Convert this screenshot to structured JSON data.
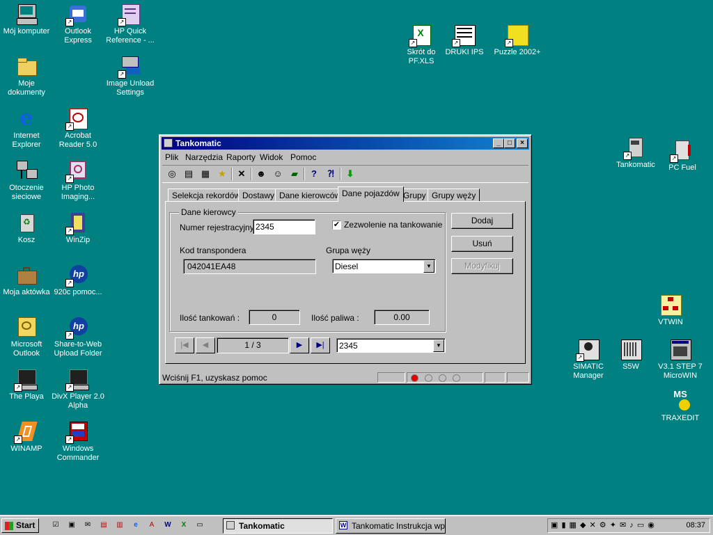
{
  "desktop_icons": [
    {
      "label": "Mój komputer",
      "icon": "computer-icon"
    },
    {
      "label": "Outlook Express",
      "icon": "outlook-express-icon"
    },
    {
      "label": "HP Quick Reference - ...",
      "icon": "hp-quick-reference-icon"
    },
    {
      "label": "Moje dokumenty",
      "icon": "folder-icon"
    },
    {
      "label": "Image Unload Settings",
      "icon": "image-unload-icon"
    },
    {
      "label": "Internet Explorer",
      "icon": "internet-explorer-icon"
    },
    {
      "label": "Acrobat Reader 5.0",
      "icon": "acrobat-icon"
    },
    {
      "label": "Otoczenie sieciowe",
      "icon": "network-icon"
    },
    {
      "label": "HP Photo Imaging...",
      "icon": "hp-photo-icon"
    },
    {
      "label": "Kosz",
      "icon": "recycle-bin-icon"
    },
    {
      "label": "WinZip",
      "icon": "winzip-icon"
    },
    {
      "label": "Moja aktówka",
      "icon": "briefcase-icon"
    },
    {
      "label": "920c pomoc...",
      "icon": "hp-920c-icon"
    },
    {
      "label": "Microsoft Outlook",
      "icon": "ms-outlook-icon"
    },
    {
      "label": "Share-to-Web Upload Folder",
      "icon": "share-to-web-icon"
    },
    {
      "label": "The Playa",
      "icon": "the-playa-icon"
    },
    {
      "label": "DivX Player 2.0 Alpha",
      "icon": "divx-icon"
    },
    {
      "label": "WINAMP",
      "icon": "winamp-icon"
    },
    {
      "label": "Windows Commander",
      "icon": "windows-commander-icon"
    },
    {
      "label": "Skrót do PF.XLS",
      "icon": "excel-icon"
    },
    {
      "label": "DRUKI IPS",
      "icon": "druki-icon"
    },
    {
      "label": "Puzzle 2002+",
      "icon": "puzzle-icon"
    },
    {
      "label": "Tankomatic",
      "icon": "tankomatic-icon"
    },
    {
      "label": "PC Fuel",
      "icon": "pc-fuel-icon"
    },
    {
      "label": "VTWIN",
      "icon": "vtwin-icon"
    },
    {
      "label": "SIMATIC Manager",
      "icon": "simatic-icon"
    },
    {
      "label": "S5W",
      "icon": "s5w-icon"
    },
    {
      "label": "V3.1 STEP 7 MicroWIN",
      "icon": "microwin-icon"
    },
    {
      "label": "TRAXEDIT",
      "icon": "traxedit-icon"
    }
  ],
  "window": {
    "title": "Tankomatic",
    "menu": [
      "Plik",
      "Narzędzia",
      "Raporty",
      "Widok",
      "Pomoc"
    ],
    "tabs": [
      "Selekcja rekordów",
      "Dostawy",
      "Dane kierowców",
      "Dane pojazdów",
      "Grupy",
      "Grupy węży"
    ],
    "active_tab": "Dane pojazdów",
    "group_title": "Dane kierowcy",
    "numer_label": "Numer rejestracyjny",
    "numer_value": "2345",
    "checkbox_label": "Zezwolenie na tankowanie",
    "checkbox_checked": true,
    "kod_label": "Kod transpondera",
    "kod_value": "042041EA48",
    "grupa_label": "Grupa węży",
    "grupa_value": "Diesel",
    "ilosc_tank_label": "Ilość tankowań :",
    "ilosc_tank_value": "0",
    "ilosc_pal_label": "Ilość paliwa :",
    "ilosc_pal_value": "0.00",
    "btn_dodaj": "Dodaj",
    "btn_usun": "Usuń",
    "btn_modyfikuj": "Modyfikuj",
    "record_position": "1 / 3",
    "record_select": "2345",
    "status_text": "Wciśnij F1, uzyskasz pomoc"
  },
  "taskbar": {
    "start_label": "Start",
    "tasks": [
      "Tankomatic",
      "Tankomatic Instrukcja wpr..."
    ],
    "clock": "08:37"
  }
}
